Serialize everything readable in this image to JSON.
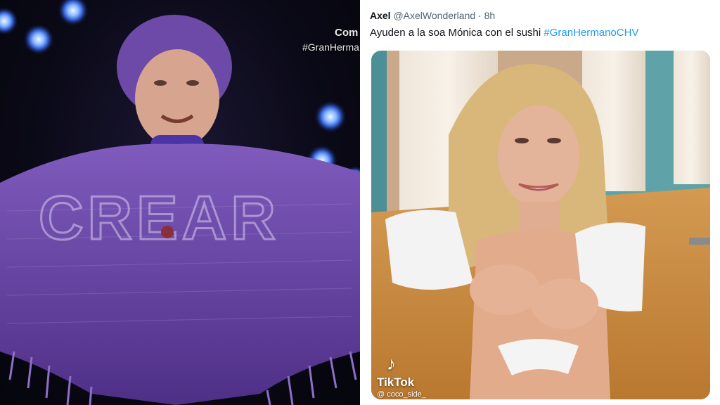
{
  "left_panel": {
    "caption_1": "Com",
    "caption_2": "#GranHerma",
    "poncho_text": "CREAR"
  },
  "tweet": {
    "name": "Axel",
    "handle": "@AxelWonderland",
    "separator": "·",
    "time": "8h",
    "text_plain": "Ayuden a la soa Mónica con el sushi ",
    "hashtag": "#GranHermanoCHV"
  },
  "media": {
    "tiktok_label": "TikTok",
    "tiktok_user": "@ coco_side_"
  },
  "colors": {
    "hashtag": "#1d9bf0",
    "poncho": "#6e4aa8",
    "stage_light": "#3f6fe6"
  }
}
